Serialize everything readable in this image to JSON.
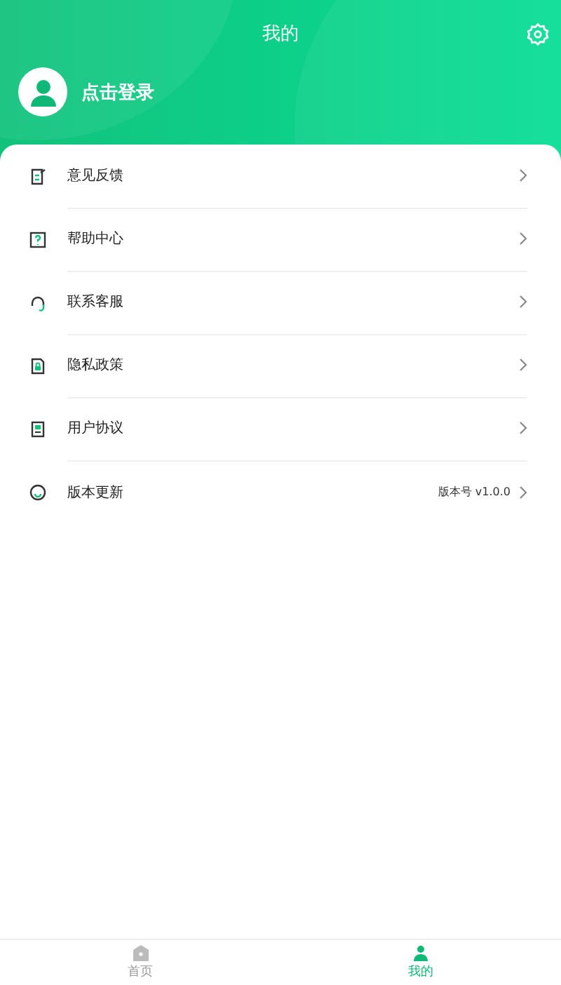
{
  "header": {
    "title": "我的",
    "login": "点击登录"
  },
  "menu": [
    {
      "label": "意见反馈"
    },
    {
      "label": "帮助中心"
    },
    {
      "label": "联系客服"
    },
    {
      "label": "隐私政策"
    },
    {
      "label": "用户协议"
    },
    {
      "label": "版本更新",
      "value": "版本号 v1.0.0"
    }
  ],
  "tabbar": [
    {
      "label": "首页",
      "selected": false
    },
    {
      "label": "我的",
      "selected": true
    }
  ]
}
